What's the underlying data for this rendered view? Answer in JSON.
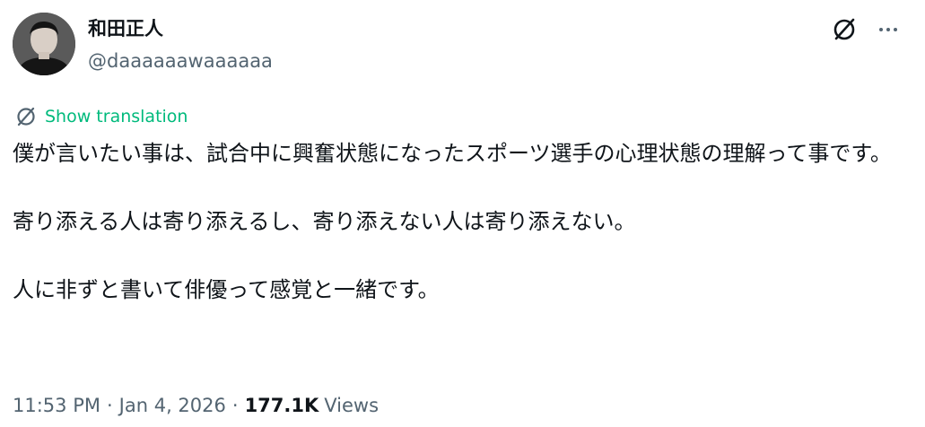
{
  "author": {
    "display_name": "和田正人",
    "handle": "@daaaaaawaaaaaa"
  },
  "header": {
    "grok_icon": "grok-slash-circle-icon",
    "more_icon": "more-horizontal-icon"
  },
  "translation": {
    "icon": "grok-slash-circle-icon",
    "label": "Show translation",
    "color": "#00ba7c"
  },
  "tweet": {
    "paragraphs": [
      "僕が言いたい事は、試合中に興奮状態になったスポーツ選手の心理状態の理解って事です。",
      "寄り添える人は寄り添えるし、寄り添えない人は寄り添えない。",
      "人に非ずと書いて俳優って感覚と一緒です。"
    ]
  },
  "meta": {
    "time": "11:53 PM",
    "date": "Jan 4, 2026",
    "separator": "·",
    "views_count": "177.1K",
    "views_label": "Views"
  },
  "colors": {
    "text_primary": "#0f1419",
    "text_secondary": "#536471",
    "accent_green": "#00ba7c",
    "background": "#ffffff"
  }
}
